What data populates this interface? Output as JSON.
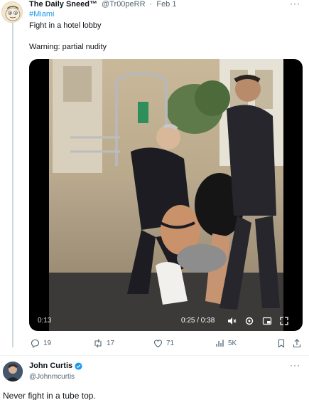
{
  "tweet1": {
    "author_name": "The Daily Sneed™",
    "handle": "@Tr00peRR",
    "dot": "·",
    "date": "Feb 1",
    "hashtag": "#Miami",
    "text_line1": "Fight in a hotel lobby",
    "text_line2": "Warning: partial nudity",
    "video": {
      "elapsed_small": "0:13",
      "time_display": "0:25 / 0:38"
    },
    "actions": {
      "replies": "19",
      "retweets": "17",
      "likes": "71",
      "views": "5K"
    }
  },
  "tweet2": {
    "author_name": "John Curtis",
    "handle": "@Johnmcurtis",
    "text": "Never fight in a tube top."
  },
  "icons": {
    "more": "more-icon",
    "reply": "reply-icon",
    "retweet": "retweet-icon",
    "like": "like-icon",
    "views": "views-icon",
    "bookmark": "bookmark-icon",
    "share": "share-icon",
    "verified": "verified-badge-icon"
  },
  "colors": {
    "link": "#1d9bf0",
    "secondary_text": "#536471",
    "primary_text": "#0f1419"
  }
}
